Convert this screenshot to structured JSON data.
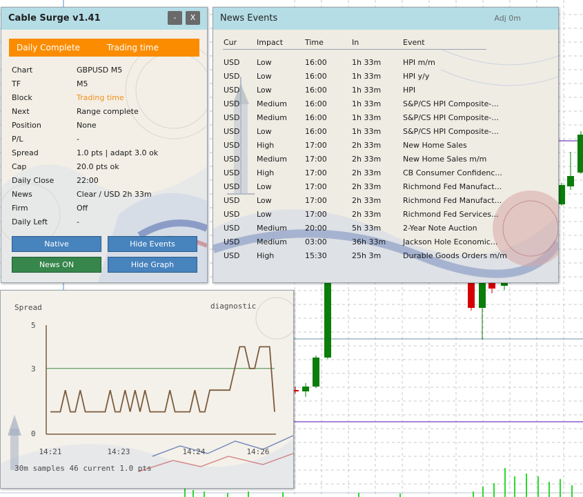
{
  "colors": {
    "accent_orange": "#fb8c00",
    "title_bg": "#b5dde6",
    "btn_blue": "#4783bd",
    "btn_green": "#37864c",
    "candle_up": "#0a7d0a",
    "candle_down": "#d50000",
    "level_purple": "#8a5ccc",
    "spread_line": "#7a5a3c",
    "threshold_line": "#3c8a3c"
  },
  "main_panel": {
    "title": "Cable Surge v1.41",
    "min_label": "-",
    "close_label": "X",
    "status_left": "Daily Complete",
    "status_right": "Trading time",
    "rows": [
      {
        "label": "Chart",
        "value": "GBPUSD M5",
        "color": "#1a1a1a"
      },
      {
        "label": "TF",
        "value": "M5",
        "color": "#1a1a1a"
      },
      {
        "label": "Block",
        "value": "Trading time",
        "color": "#f0901a"
      },
      {
        "label": "Next",
        "value": "Range complete",
        "color": "#1a1a1a"
      },
      {
        "label": "Position",
        "value": "None",
        "color": "#1a1a1a"
      },
      {
        "label": "P/L",
        "value": "-",
        "color": "#1a1a1a"
      },
      {
        "label": "Spread",
        "value": "1.0 pts | adapt 3.0 ok",
        "color": "#1a1a1a"
      },
      {
        "label": "Cap",
        "value": "20.0 pts ok",
        "color": "#1a1a1a"
      },
      {
        "label": "Daily Close",
        "value": "22:00",
        "color": "#1a1a1a"
      },
      {
        "label": "News",
        "value": "Clear / USD 2h 33m",
        "color": "#1a1a1a"
      },
      {
        "label": "Firm",
        "value": "Off",
        "color": "#1a1a1a"
      },
      {
        "label": "Daily Left",
        "value": "-",
        "color": "#1a1a1a"
      }
    ],
    "buttons": {
      "native": "Native",
      "hide_events": "Hide Events",
      "news_on": "News ON",
      "hide_graph": "Hide Graph"
    }
  },
  "news_panel": {
    "title": "News Events",
    "adj": "Adj 0m",
    "headers": {
      "cur": "Cur",
      "impact": "Impact",
      "time": "Time",
      "in": "In",
      "event": "Event"
    },
    "rows": [
      {
        "cur": "USD",
        "impact": "Low",
        "time": "16:00",
        "in": "1h 33m",
        "event": "HPI m/m"
      },
      {
        "cur": "USD",
        "impact": "Low",
        "time": "16:00",
        "in": "1h 33m",
        "event": "HPI y/y"
      },
      {
        "cur": "USD",
        "impact": "Low",
        "time": "16:00",
        "in": "1h 33m",
        "event": "HPI"
      },
      {
        "cur": "USD",
        "impact": "Medium",
        "time": "16:00",
        "in": "1h 33m",
        "event": "S&P/CS HPI Composite-..."
      },
      {
        "cur": "USD",
        "impact": "Medium",
        "time": "16:00",
        "in": "1h 33m",
        "event": "S&P/CS HPI Composite-..."
      },
      {
        "cur": "USD",
        "impact": "Low",
        "time": "16:00",
        "in": "1h 33m",
        "event": "S&P/CS HPI Composite-..."
      },
      {
        "cur": "USD",
        "impact": "High",
        "time": "17:00",
        "in": "2h 33m",
        "event": "New Home Sales"
      },
      {
        "cur": "USD",
        "impact": "Medium",
        "time": "17:00",
        "in": "2h 33m",
        "event": "New Home Sales m/m"
      },
      {
        "cur": "USD",
        "impact": "High",
        "time": "17:00",
        "in": "2h 33m",
        "event": "CB Consumer Confidenc..."
      },
      {
        "cur": "USD",
        "impact": "Low",
        "time": "17:00",
        "in": "2h 33m",
        "event": "Richmond Fed Manufact..."
      },
      {
        "cur": "USD",
        "impact": "Low",
        "time": "17:00",
        "in": "2h 33m",
        "event": "Richmond Fed Manufact..."
      },
      {
        "cur": "USD",
        "impact": "Low",
        "time": "17:00",
        "in": "2h 33m",
        "event": "Richmond Fed Services..."
      },
      {
        "cur": "USD",
        "impact": "Medium",
        "time": "20:00",
        "in": "5h 33m",
        "event": "2-Year Note Auction"
      },
      {
        "cur": "USD",
        "impact": "Medium",
        "time": "03:00",
        "in": "36h 33m",
        "event": "Jackson Hole Economic..."
      },
      {
        "cur": "USD",
        "impact": "High",
        "time": "15:30",
        "in": "25h 3m",
        "event": "Durable Goods Orders m/m"
      }
    ]
  },
  "spread_panel": {
    "title": "Spread",
    "tag": "diagnostic",
    "footer": "30m samples 46   current 1.0 pts",
    "y_ticks": [
      "5",
      "3",
      "0"
    ],
    "x_ticks": [
      "14:21",
      "14:23",
      "14:24",
      "14:26"
    ]
  },
  "chart_data": {
    "type": "line",
    "title": "Spread",
    "subtitle": "diagnostic",
    "ylim": [
      0,
      5
    ],
    "x_ticks": [
      "14:21",
      "14:23",
      "14:24",
      "14:26"
    ],
    "threshold": 3.0,
    "series": [
      {
        "values": [
          1,
          1,
          1,
          2,
          1,
          1,
          2,
          1,
          1,
          1,
          1,
          1,
          2,
          1,
          1,
          2,
          1,
          2,
          1,
          2,
          1,
          1,
          1,
          1,
          2,
          1,
          1,
          1,
          1,
          2,
          1,
          1,
          2,
          2,
          2,
          2,
          2,
          3,
          4,
          4,
          3,
          3,
          4,
          4,
          4,
          1
        ]
      }
    ]
  }
}
